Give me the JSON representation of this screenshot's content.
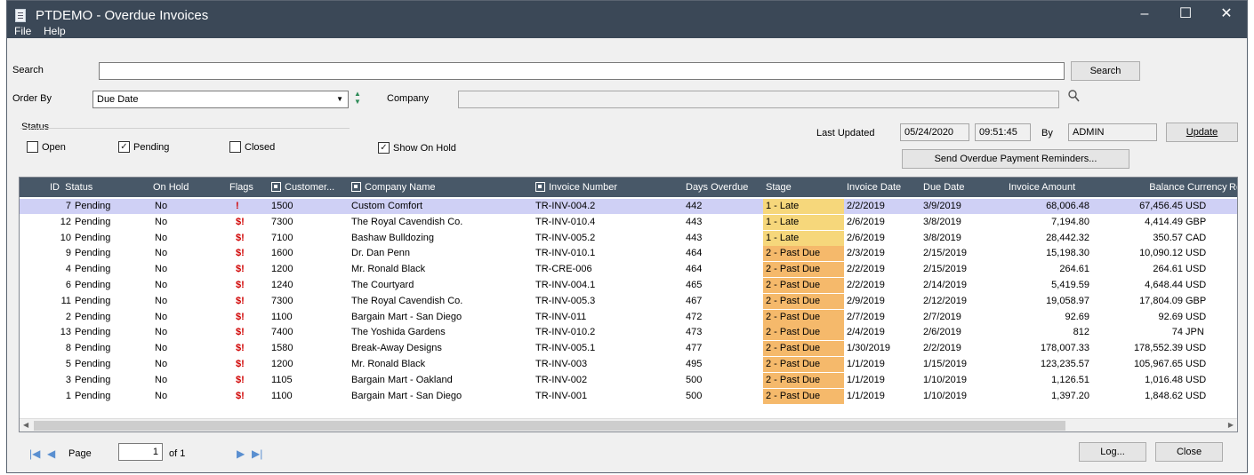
{
  "window": {
    "title": "PTDEMO - Overdue Invoices",
    "controls": {
      "minimize": "–",
      "maximize": "☐",
      "close": "✕"
    }
  },
  "menu": {
    "file": "File",
    "help": "Help"
  },
  "search": {
    "label": "Search",
    "value": "",
    "button": "Search"
  },
  "order_by": {
    "label": "Order By",
    "value": "Due Date"
  },
  "company": {
    "label": "Company",
    "value": ""
  },
  "status": {
    "label": "Status",
    "open": {
      "label": "Open",
      "checked": false
    },
    "pending": {
      "label": "Pending",
      "checked": true
    },
    "closed": {
      "label": "Closed",
      "checked": false
    },
    "show_on_hold": {
      "label": "Show On Hold",
      "checked": true
    }
  },
  "last_updated": {
    "label": "Last Updated",
    "date": "05/24/2020",
    "time": "09:51:45",
    "by_label": "By",
    "by_value": "ADMIN",
    "update_button": "Update",
    "reminders_button": "Send Overdue Payment Reminders..."
  },
  "grid": {
    "headers": {
      "id": "ID",
      "status": "Status",
      "on_hold": "On Hold",
      "flags": "Flags",
      "customer": "Customer...",
      "company": "Company Name",
      "invoice_number": "Invoice Number",
      "days_overdue": "Days Overdue",
      "stage": "Stage",
      "invoice_date": "Invoice Date",
      "due_date": "Due Date",
      "invoice_amount": "Invoice Amount",
      "balance": "Balance",
      "currency": "Currency",
      "re": "Re"
    },
    "rows": [
      {
        "id": "7",
        "status": "Pending",
        "on_hold": "No",
        "flags": "!",
        "customer": "1500",
        "company": "Custom Comfort",
        "invoice": "TR-INV-004.2",
        "days": "442",
        "stage": "1 - Late",
        "inv_date": "2/2/2019",
        "due_date": "3/9/2019",
        "amount": "68,006.48",
        "balance": "67,456.45",
        "currency": "USD"
      },
      {
        "id": "12",
        "status": "Pending",
        "on_hold": "No",
        "flags": "$!",
        "customer": "7300",
        "company": "The Royal Cavendish Co.",
        "invoice": "TR-INV-010.4",
        "days": "443",
        "stage": "1 - Late",
        "inv_date": "2/6/2019",
        "due_date": "3/8/2019",
        "amount": "7,194.80",
        "balance": "4,414.49",
        "currency": "GBP"
      },
      {
        "id": "10",
        "status": "Pending",
        "on_hold": "No",
        "flags": "$!",
        "customer": "7100",
        "company": "Bashaw Bulldozing",
        "invoice": "TR-INV-005.2",
        "days": "443",
        "stage": "1 - Late",
        "inv_date": "2/6/2019",
        "due_date": "3/8/2019",
        "amount": "28,442.32",
        "balance": "350.57",
        "currency": "CAD"
      },
      {
        "id": "9",
        "status": "Pending",
        "on_hold": "No",
        "flags": "$!",
        "customer": "1600",
        "company": "Dr. Dan Penn",
        "invoice": "TR-INV-010.1",
        "days": "464",
        "stage": "2 - Past Due",
        "inv_date": "2/3/2019",
        "due_date": "2/15/2019",
        "amount": "15,198.30",
        "balance": "10,090.12",
        "currency": "USD"
      },
      {
        "id": "4",
        "status": "Pending",
        "on_hold": "No",
        "flags": "$!",
        "customer": "1200",
        "company": "Mr. Ronald Black",
        "invoice": "TR-CRE-006",
        "days": "464",
        "stage": "2 - Past Due",
        "inv_date": "2/2/2019",
        "due_date": "2/15/2019",
        "amount": "264.61",
        "balance": "264.61",
        "currency": "USD"
      },
      {
        "id": "6",
        "status": "Pending",
        "on_hold": "No",
        "flags": "$!",
        "customer": "1240",
        "company": "The Courtyard",
        "invoice": "TR-INV-004.1",
        "days": "465",
        "stage": "2 - Past Due",
        "inv_date": "2/2/2019",
        "due_date": "2/14/2019",
        "amount": "5,419.59",
        "balance": "4,648.44",
        "currency": "USD"
      },
      {
        "id": "11",
        "status": "Pending",
        "on_hold": "No",
        "flags": "$!",
        "customer": "7300",
        "company": "The Royal Cavendish Co.",
        "invoice": "TR-INV-005.3",
        "days": "467",
        "stage": "2 - Past Due",
        "inv_date": "2/9/2019",
        "due_date": "2/12/2019",
        "amount": "19,058.97",
        "balance": "17,804.09",
        "currency": "GBP"
      },
      {
        "id": "2",
        "status": "Pending",
        "on_hold": "No",
        "flags": "$!",
        "customer": "1100",
        "company": "Bargain Mart - San Diego",
        "invoice": "TR-INV-011",
        "days": "472",
        "stage": "2 - Past Due",
        "inv_date": "2/7/2019",
        "due_date": "2/7/2019",
        "amount": "92.69",
        "balance": "92.69",
        "currency": "USD"
      },
      {
        "id": "13",
        "status": "Pending",
        "on_hold": "No",
        "flags": "$!",
        "customer": "7400",
        "company": "The Yoshida Gardens",
        "invoice": "TR-INV-010.2",
        "days": "473",
        "stage": "2 - Past Due",
        "inv_date": "2/4/2019",
        "due_date": "2/6/2019",
        "amount": "812",
        "balance": "74",
        "currency": "JPN"
      },
      {
        "id": "8",
        "status": "Pending",
        "on_hold": "No",
        "flags": "$!",
        "customer": "1580",
        "company": "Break-Away Designs",
        "invoice": "TR-INV-005.1",
        "days": "477",
        "stage": "2 - Past Due",
        "inv_date": "1/30/2019",
        "due_date": "2/2/2019",
        "amount": "178,007.33",
        "balance": "178,552.39",
        "currency": "USD"
      },
      {
        "id": "5",
        "status": "Pending",
        "on_hold": "No",
        "flags": "$!",
        "customer": "1200",
        "company": "Mr. Ronald Black",
        "invoice": "TR-INV-003",
        "days": "495",
        "stage": "2 - Past Due",
        "inv_date": "1/1/2019",
        "due_date": "1/15/2019",
        "amount": "123,235.57",
        "balance": "105,967.65",
        "currency": "USD"
      },
      {
        "id": "3",
        "status": "Pending",
        "on_hold": "No",
        "flags": "$!",
        "customer": "1105",
        "company": "Bargain Mart - Oakland",
        "invoice": "TR-INV-002",
        "days": "500",
        "stage": "2 - Past Due",
        "inv_date": "1/1/2019",
        "due_date": "1/10/2019",
        "amount": "1,126.51",
        "balance": "1,016.48",
        "currency": "USD"
      },
      {
        "id": "1",
        "status": "Pending",
        "on_hold": "No",
        "flags": "$!",
        "customer": "1100",
        "company": "Bargain Mart - San Diego",
        "invoice": "TR-INV-001",
        "days": "500",
        "stage": "2 - Past Due",
        "inv_date": "1/1/2019",
        "due_date": "1/10/2019",
        "amount": "1,397.20",
        "balance": "1,848.62",
        "currency": "USD"
      }
    ]
  },
  "pager": {
    "label": "Page",
    "value": "1",
    "of_label": "of 1"
  },
  "buttons": {
    "log": "Log...",
    "close": "Close"
  }
}
